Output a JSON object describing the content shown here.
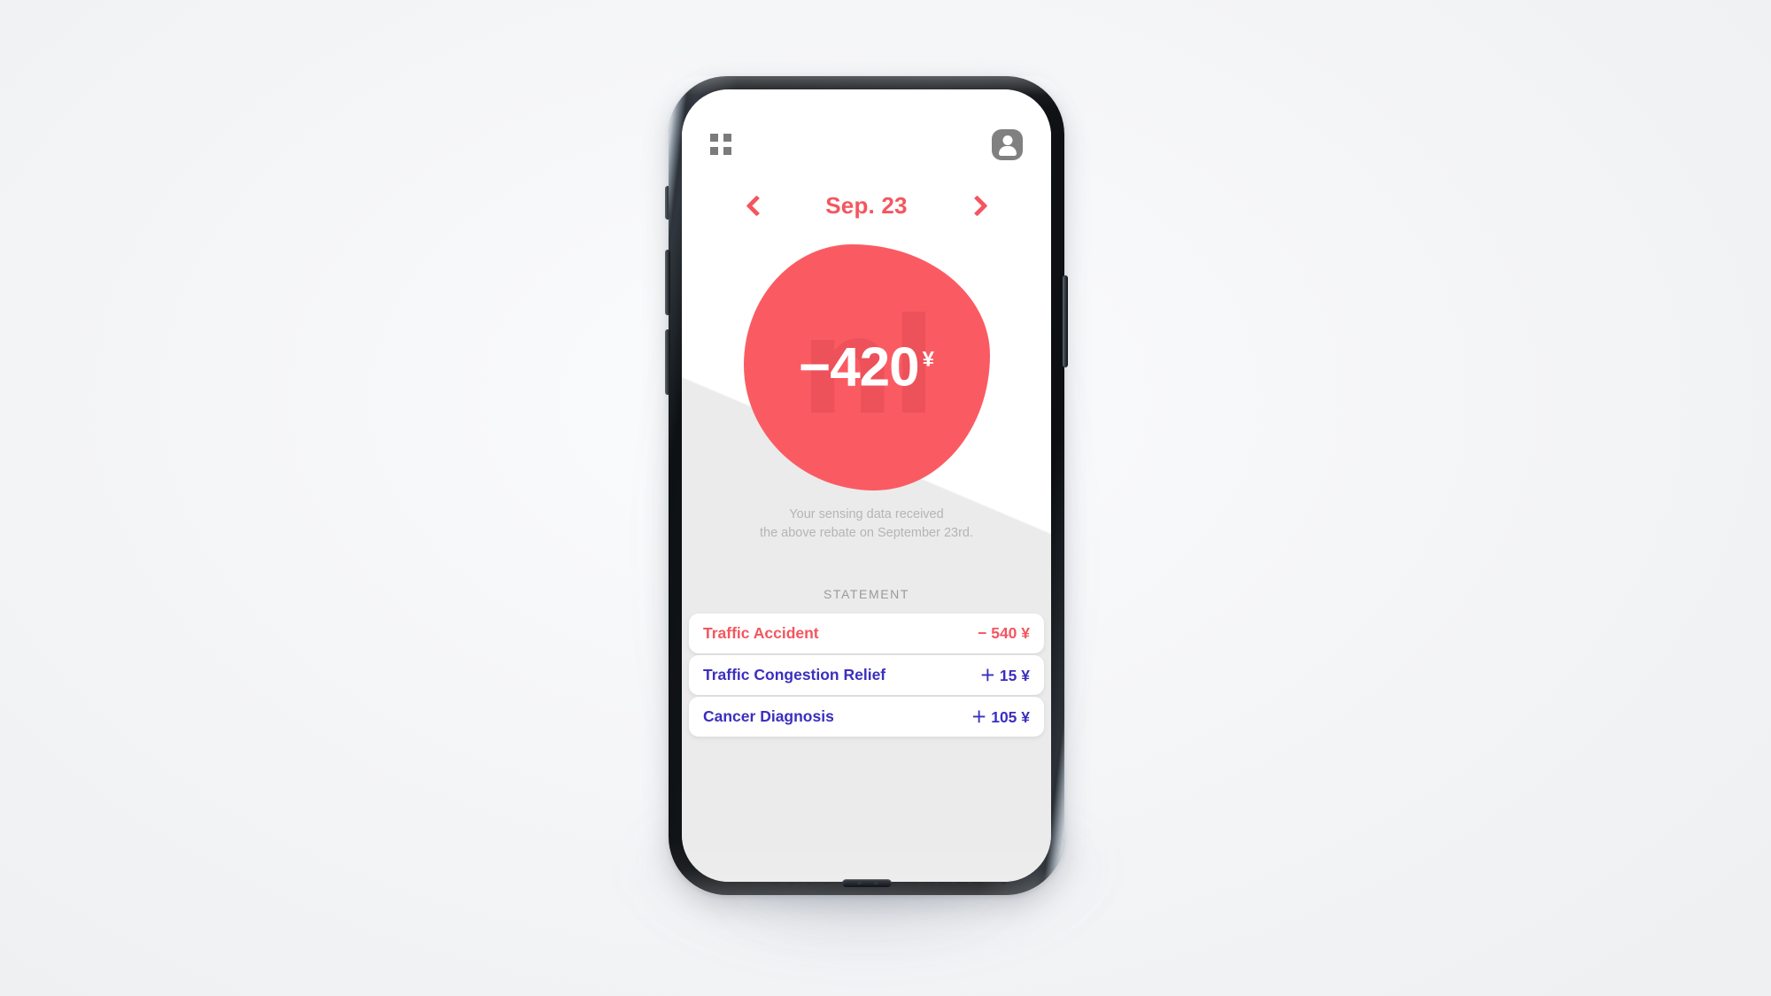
{
  "app": {
    "topbar": {
      "grid_icon": "grid-icon",
      "avatar_icon": "account-avatar-icon"
    },
    "date_nav": {
      "prev_icon": "chevron-left-icon",
      "next_icon": "chevron-right-icon",
      "date_label": "Sep. 23"
    },
    "balance": {
      "watermark": "nl",
      "amount": "−420",
      "currency": "¥"
    },
    "caption": {
      "line1": "Your sensing data received",
      "line2": "the above rebate on September 23rd."
    },
    "statement": {
      "section_label": "STATEMENT",
      "rows": [
        {
          "label": "Traffic Accident",
          "amount": "− 540 ¥",
          "sign": "negative"
        },
        {
          "label": "Traffic Congestion Relief",
          "amount": "＋ 15 ¥",
          "sign": "positive"
        },
        {
          "label": "Cancer Diagnosis",
          "amount": "＋ 105 ¥",
          "sign": "positive"
        }
      ]
    }
  },
  "colors": {
    "accent_red": "#fa5b63",
    "accent_blue": "#3b2fbf",
    "screen_grey": "#ebebeb",
    "page_bg": "#f4f5f7",
    "muted_text": "#b5b5b5"
  }
}
